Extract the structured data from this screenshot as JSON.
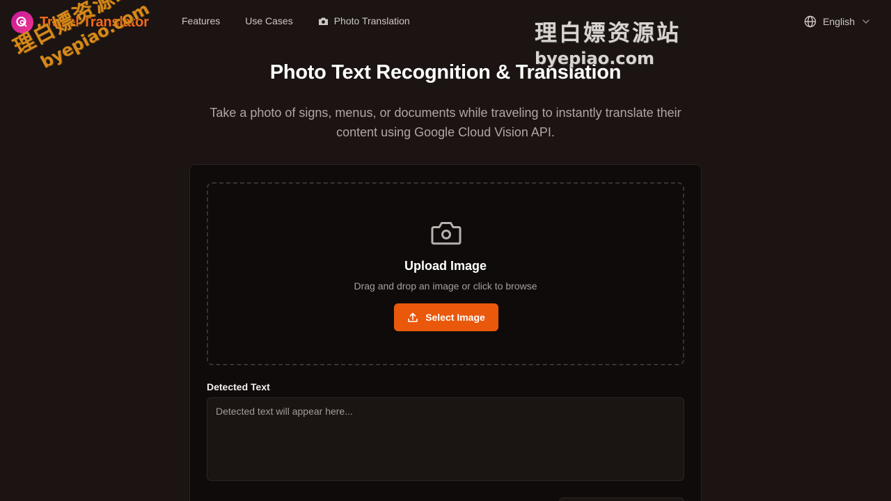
{
  "header": {
    "brand": "Travel Translator",
    "nav": [
      {
        "label": "Features"
      },
      {
        "label": "Use Cases"
      },
      {
        "label": "Photo Translation"
      }
    ],
    "language": "English"
  },
  "hero": {
    "title": "Photo Text Recognition & Translation",
    "subtitle": "Take a photo of signs, menus, or documents while traveling to instantly translate their content using Google Cloud Vision API."
  },
  "upload": {
    "title": "Upload Image",
    "hint": "Drag and drop an image or click to browse",
    "button_label": "Select Image"
  },
  "detected": {
    "label": "Detected Text",
    "placeholder": "Detected text will appear here...",
    "value": ""
  },
  "watermark": {
    "cn": "理白嫖资源站",
    "domain": "byepiao.com"
  },
  "colors": {
    "accent": "#ea580c",
    "brand_text": "#f26a1b",
    "background": "#1b1413",
    "card": "#0f0b0a"
  }
}
